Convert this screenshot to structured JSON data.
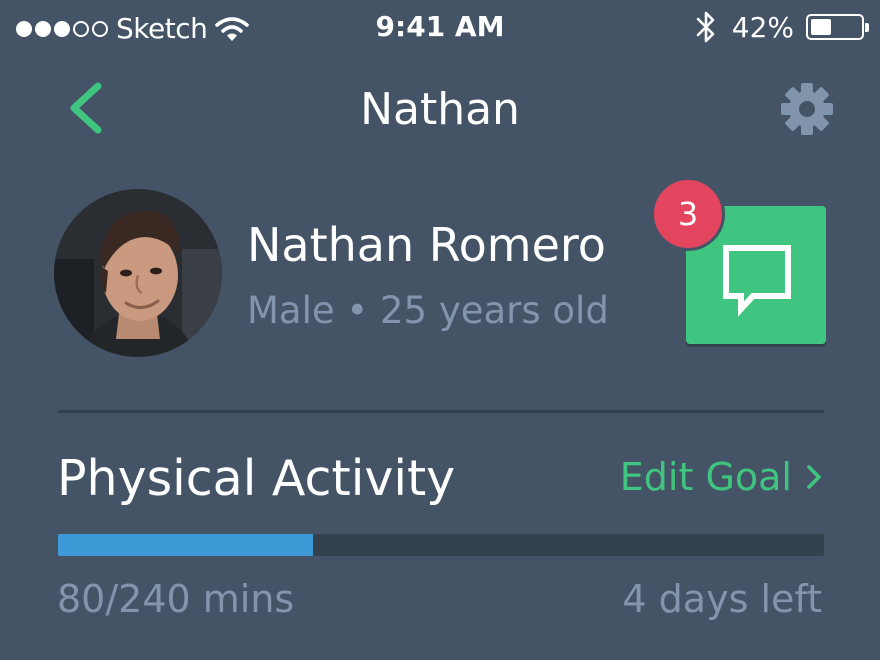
{
  "status_bar": {
    "signal_bars_filled": 3,
    "signal_bars_total": 5,
    "carrier": "Sketch",
    "time": "9:41 AM",
    "battery_percent": "42%",
    "battery_level": 0.42
  },
  "nav": {
    "back_icon": "chevron-left-icon",
    "title": "Nathan",
    "settings_icon": "gear-icon"
  },
  "profile": {
    "name": "Nathan Romero",
    "meta": "Male • 25 years old",
    "avatar": "profile-photo",
    "message_icon": "chat-bubble-icon",
    "unread_count": "3"
  },
  "activity": {
    "title": "Physical Activity",
    "edit_label": "Edit Goal",
    "progress_label": "80/240 mins",
    "progress_value": 80,
    "progress_max": 240,
    "days_left": "4 days left"
  },
  "colors": {
    "background": "#445466",
    "accent": "#3fc57f",
    "badge": "#e3455f",
    "progress": "#3d9ad6",
    "muted_text": "#8295ad"
  }
}
